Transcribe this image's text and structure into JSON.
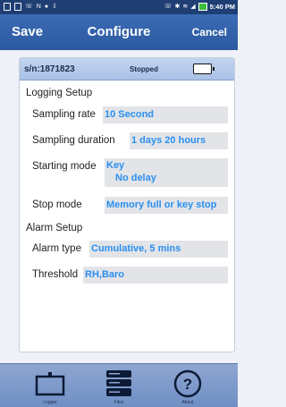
{
  "status_bar": {
    "time": "5:40 PM"
  },
  "header": {
    "save_label": "Save",
    "title": "Configure",
    "cancel_label": "Cancel"
  },
  "device": {
    "serial": "s/n:1871823",
    "status": "Stopped"
  },
  "logging_setup": {
    "title": "Logging Setup",
    "sampling_rate": {
      "label": "Sampling rate",
      "value": "10 Second"
    },
    "sampling_duration": {
      "label": "Sampling duration",
      "value": "1 days 20 hours"
    },
    "starting_mode": {
      "label": "Starting mode",
      "value_line1": "Key",
      "value_line2": "No delay"
    },
    "stop_mode": {
      "label": "Stop mode",
      "value": "Memory full or key stop"
    }
  },
  "alarm_setup": {
    "title": "Alarm Setup",
    "alarm_type": {
      "label": "Alarm type",
      "value": "Cumulative, 5 mins"
    },
    "threshold": {
      "label": "Threshold",
      "value": "RH,Baro"
    }
  },
  "tabs": [
    {
      "label": "Logger",
      "icon": "logger-icon"
    },
    {
      "label": "Files",
      "icon": "files-icon"
    },
    {
      "label": "About",
      "icon": "about-icon"
    }
  ],
  "colors": {
    "header": "#2c5aa0",
    "value_text": "#2a8ff0",
    "value_bg": "#e2e4e8",
    "tab_bar": "#7a98c9"
  }
}
